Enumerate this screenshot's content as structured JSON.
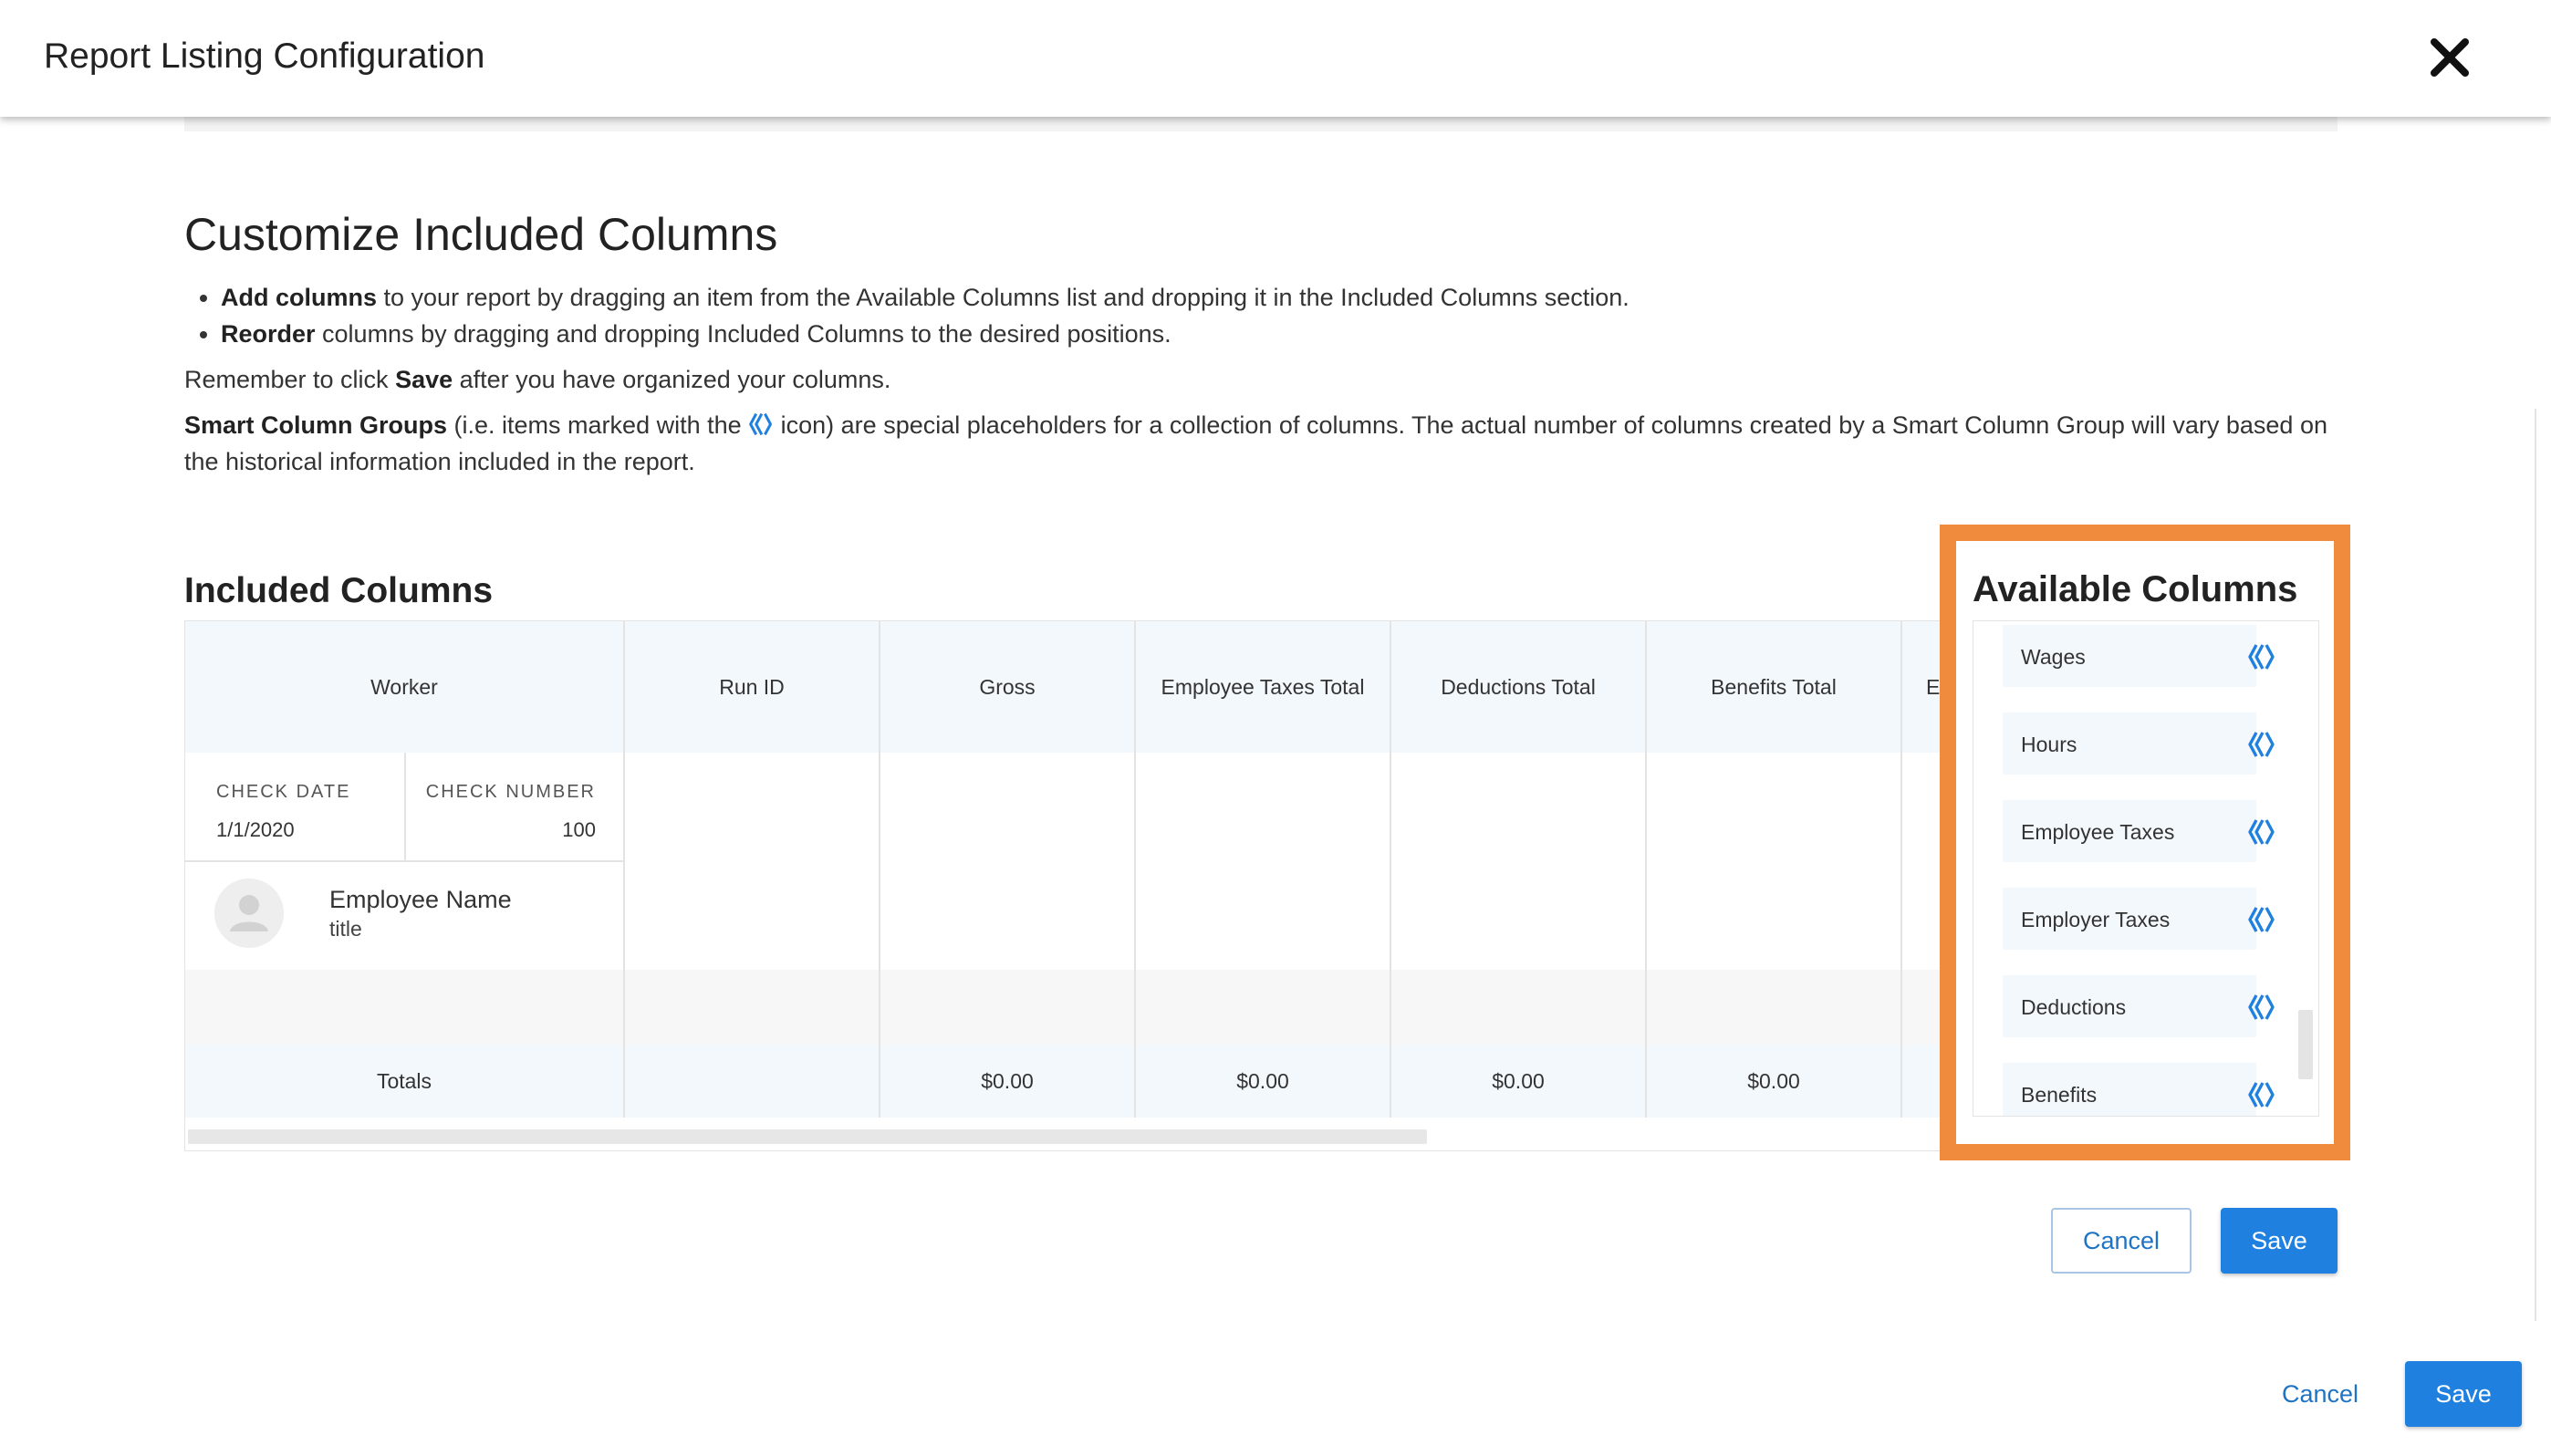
{
  "header": {
    "title": "Report Listing Configuration"
  },
  "section": {
    "title": "Customize Included Columns",
    "bullets": [
      {
        "bold": "Add columns",
        "rest": " to your report by dragging an item from the Available Columns list and dropping it in the Included Columns section."
      },
      {
        "bold": "Reorder",
        "rest": " columns by dragging and dropping Included Columns to the desired positions."
      }
    ],
    "remember": {
      "pre": "Remember to click ",
      "bold": "Save",
      "post": " after you have organized your columns."
    },
    "smart": {
      "bold": "Smart Column Groups",
      "pre": " (i.e. items marked with the ",
      "post": " icon) are special placeholders for a collection of columns. The actual number of columns created by a Smart Column Group will vary based on the historical information included in the report."
    }
  },
  "included": {
    "title": "Included Columns",
    "worker": {
      "header": "Worker",
      "check_date_label": "CHECK DATE",
      "check_date_value": "1/1/2020",
      "check_number_label": "CHECK NUMBER",
      "check_number_value": "100",
      "employee_name": "Employee Name",
      "employee_title": "title",
      "totals_label": "Totals"
    },
    "columns": [
      {
        "header": "Run ID",
        "total": ""
      },
      {
        "header": "Gross",
        "total": "$0.00"
      },
      {
        "header": "Employee Taxes Total",
        "total": "$0.00"
      },
      {
        "header": "Deductions Total",
        "total": "$0.00"
      },
      {
        "header": "Benefits Total",
        "total": "$0.00"
      },
      {
        "header": "E",
        "total": ""
      }
    ]
  },
  "available": {
    "title": "Available Columns",
    "items": [
      "Wages",
      "Hours",
      "Employee Taxes",
      "Employer Taxes",
      "Deductions",
      "Benefits"
    ],
    "icon": "smart-column-group-icon"
  },
  "dialog_buttons": {
    "cancel": "Cancel",
    "save": "Save"
  },
  "footer_buttons": {
    "cancel": "Cancel",
    "save": "Save"
  },
  "colors": {
    "accent": "#1f80e0",
    "highlight": "#f08a3c",
    "header_bg": "#f3f8fd"
  }
}
